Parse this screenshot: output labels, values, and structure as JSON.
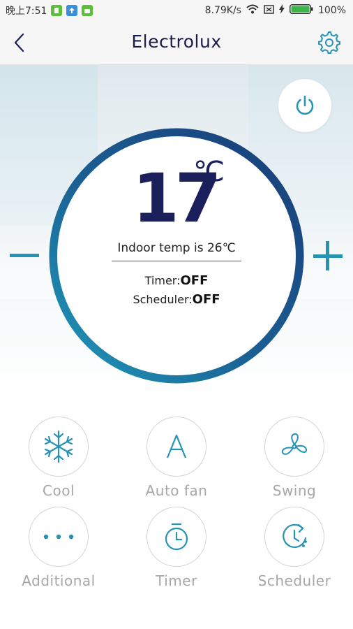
{
  "status_bar": {
    "time": "晚上7:51",
    "speed": "8.79K/s",
    "battery": "100%"
  },
  "header": {
    "title": "Electrolux",
    "back_icon": "chevron-left-icon",
    "settings_icon": "gear-icon"
  },
  "thermostat": {
    "set_temp": "17",
    "unit": "℃",
    "indoor_text": "Indoor temp is 26℃",
    "timer_label": "Timer:",
    "timer_value": "OFF",
    "scheduler_label": "Scheduler:",
    "scheduler_value": "OFF"
  },
  "modes": [
    {
      "label": "Cool",
      "icon": "snowflake-icon"
    },
    {
      "label": "Auto fan",
      "icon": "letter-a-icon"
    },
    {
      "label": "Swing",
      "icon": "fan-icon"
    },
    {
      "label": "Additional",
      "icon": "more-dots-icon"
    },
    {
      "label": "Timer",
      "icon": "stopwatch-icon"
    },
    {
      "label": "Scheduler",
      "icon": "clock-schedule-icon"
    }
  ],
  "colors": {
    "accent": "#2693b5",
    "navy": "#1b1f5c",
    "ring_start": "#1a3c78",
    "ring_end": "#1f95b7"
  }
}
